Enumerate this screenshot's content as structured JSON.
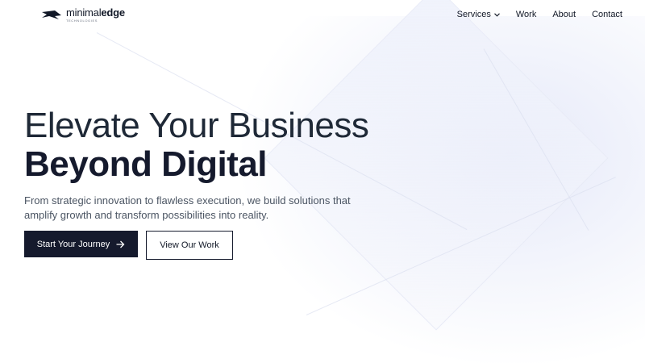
{
  "brand": {
    "name_regular": "minimal",
    "name_bold": "edge",
    "tagline": "TECHNOLOGIES"
  },
  "nav": {
    "items": [
      {
        "label": "Services",
        "has_dropdown": true
      },
      {
        "label": "Work"
      },
      {
        "label": "About"
      },
      {
        "label": "Contact"
      }
    ]
  },
  "hero": {
    "title_line_1": "Elevate Your Business",
    "title_line_2": "Beyond Digital",
    "description": "From strategic innovation to flawless execution, we build solutions that amplify growth and transform possibilities into reality.",
    "primary_cta": "Start Your Journey",
    "secondary_cta": "View Our Work"
  },
  "colors": {
    "primary": "#151a2d",
    "text": "#111827",
    "muted": "#4b5563",
    "background_accent": "#e8ebf8"
  },
  "icons": {
    "logo": "logo-mark-icon",
    "dropdown": "chevron-down-icon",
    "cta_arrow": "arrow-right-icon"
  }
}
